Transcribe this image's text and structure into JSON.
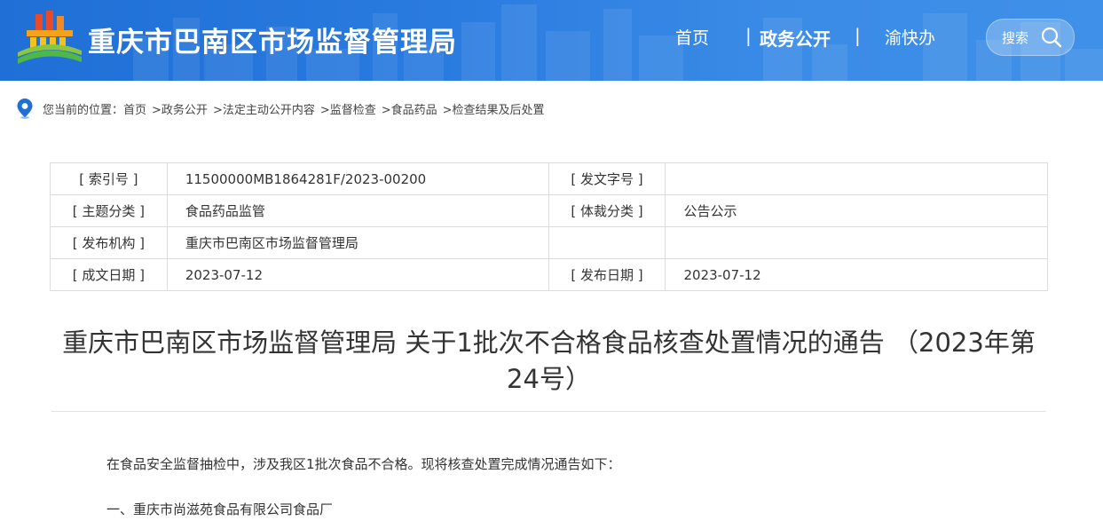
{
  "header": {
    "site_title": "重庆市巴南区市场监督管理局",
    "nav": {
      "home": "首页",
      "gov_affairs": "政务公开",
      "separator": "|",
      "yukuaiban": "渝快办"
    },
    "search_label": "搜索"
  },
  "breadcrumb": {
    "prefix": "您当前的位置：",
    "items": [
      "首页",
      ">政务公开",
      ">法定主动公开内容",
      ">监督检查",
      ">食品药品",
      ">检查结果及后处置"
    ]
  },
  "meta": {
    "rows": [
      {
        "label1": "[ 索引号 ]",
        "value1": "11500000MB1864281F/2023-00200",
        "label2": "[ 发文字号 ]",
        "value2": ""
      },
      {
        "label1": "[ 主题分类 ]",
        "value1": "食品药品监管",
        "label2": "[ 体裁分类 ]",
        "value2": "公告公示"
      },
      {
        "label1": "[ 发布机构 ]",
        "value1": "重庆市巴南区市场监督管理局",
        "label2": "",
        "value2": ""
      },
      {
        "label1": "[ 成文日期 ]",
        "value1": "2023-07-12",
        "label2": "[ 发布日期 ]",
        "value2": "2023-07-12"
      }
    ]
  },
  "article": {
    "title_line1": "重庆市巴南区市场监督管理局 关于1批次不合格食品核查处置情况的通告 （2023年第",
    "title_line2": "24号）",
    "paragraph1": "在食品安全监督抽检中，涉及我区1批次食品不合格。现将核查处置完成情况通告如下：",
    "paragraph2": "一、重庆市尚滋苑食品有限公司食品厂"
  },
  "colors": {
    "header_blue": "#2a7be0",
    "border": "#dcdcdc",
    "text": "#333333"
  }
}
